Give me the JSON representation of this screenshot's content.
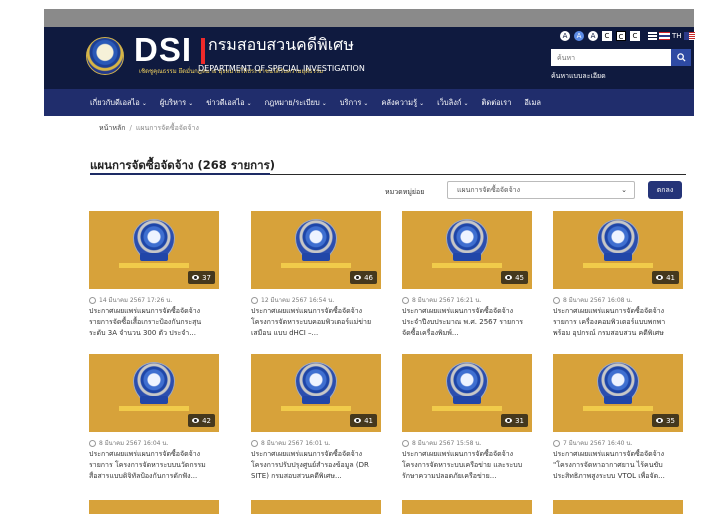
{
  "header": {
    "logo_mark": "DSI",
    "org_name_th": "กรมสอบสวนคดีพิเศษ",
    "motto_th": "เชิดชูคุณธรรม ยึดมั่นกฎหมาย มุ่งหมายให้ประชาชนได้รับความยุติธรรม",
    "org_name_en": "DEPARTMENT OF SPECIAL INVESTIGATION",
    "accessibility": [
      "A",
      "A",
      "A",
      "C",
      "C",
      "C"
    ],
    "lang_th": "TH",
    "lang_en": "EN",
    "search_placeholder": "ค้นหา",
    "advanced_search": "ค้นหาแบบละเอียด"
  },
  "nav": {
    "items": [
      {
        "label": "เกี่ยวกับดีเอสไอ",
        "dropdown": true
      },
      {
        "label": "ผู้บริหาร",
        "dropdown": true
      },
      {
        "label": "ข่าวดีเอสไอ",
        "dropdown": true
      },
      {
        "label": "กฎหมาย/ระเบียบ",
        "dropdown": true
      },
      {
        "label": "บริการ",
        "dropdown": true
      },
      {
        "label": "คลังความรู้",
        "dropdown": true
      },
      {
        "label": "เว็บลิงก์",
        "dropdown": true
      },
      {
        "label": "ติดต่อเรา",
        "dropdown": false
      },
      {
        "label": "อีเมล",
        "dropdown": false
      }
    ]
  },
  "breadcrumb": {
    "home": "หน้าหลัก",
    "separator": "/",
    "current": "แผนการจัดซื้อจัดจ้าง"
  },
  "page": {
    "title": "แผนการจัดซื้อจัดจ้าง (268 รายการ)"
  },
  "filter": {
    "label": "หมวดหมู่ย่อย",
    "selected": "แผนการจัดซื้อจัดจ้าง",
    "button": "ตกลง"
  },
  "cards": [
    {
      "views": "37",
      "date": "14 มีนาคม 2567 17:26 น.",
      "desc": "ประกาศเผยแพร่แผนการจัดซื้อจัดจ้าง รายการจัดซื้อเสื้อเกราะป้องกันกระสุน ระดับ 3A จำนวน 300 ตัว ประจำ..."
    },
    {
      "views": "46",
      "date": "12 มีนาคม 2567 16:54 น.",
      "desc": "ประกาศเผยแพร่แผนการจัดซื้อจัดจ้าง โครงการจัดหาระบบคอมพิวเตอร์แม่ข่ายเสมือน แบบ dHCI –..."
    },
    {
      "views": "45",
      "date": "8 มีนาคม 2567 16:21 น.",
      "desc": "ประกาศเผยแพร่แผนการจัดซื้อจัดจ้าง ประจำปีงบประมาณ พ.ศ. 2567 รายการจัดซื้อเครื่องพิมพ์..."
    },
    {
      "views": "41",
      "date": "8 มีนาคม 2567 16:08 น.",
      "desc": "ประกาศเผยแพร่แผนการจัดซื้อจัดจ้าง รายการ เครื่องคอมพิวเตอร์แบบพกพาพร้อม อุปกรณ์ กรมสอบสวน คดีพิเศษ แขว..."
    },
    {
      "views": "42",
      "date": "8 มีนาคม 2567 16:04 น.",
      "desc": "ประกาศเผยแพร่แผนการจัดซื้อจัดจ้าง รายการ โครงการจัดหาระบบนวัตกรรมสื่อสารแบบดิจิทัลป้องกันการดักฟัง..."
    },
    {
      "views": "41",
      "date": "8 มีนาคม 2567 16:01 น.",
      "desc": "ประกาศเผยแพร่แผนการจัดซื้อจัดจ้าง โครงการปรับปรุงศูนย์สำรองข้อมูล (DR SITE) กรมสอบสวนคดีพิเศษ..."
    },
    {
      "views": "31",
      "date": "8 มีนาคม 2567 15:58 น.",
      "desc": "ประกาศเผยแพร่แผนการจัดซื้อจัดจ้าง โครงการจัดหาระบบเครือข่าย และระบบรักษาความปลอดภัยเครือข่าย..."
    },
    {
      "views": "35",
      "date": "7 มีนาคม 2567 16:40 น.",
      "desc": "ประกาศเผยแพร่แผนการจัดซื้อจัดจ้าง \"โครงการจัดหาอากาศยาน ไร้คนขับ ประสิทธิภาพสูงระบบ VTOL เพื่อจัด..."
    }
  ],
  "colors": {
    "header_bg": "#0f1a3f",
    "nav_bg": "#202d6c",
    "thumb_bg": "#d7a23a",
    "accent_red": "#ef2a2a",
    "button_bg": "#253478"
  }
}
